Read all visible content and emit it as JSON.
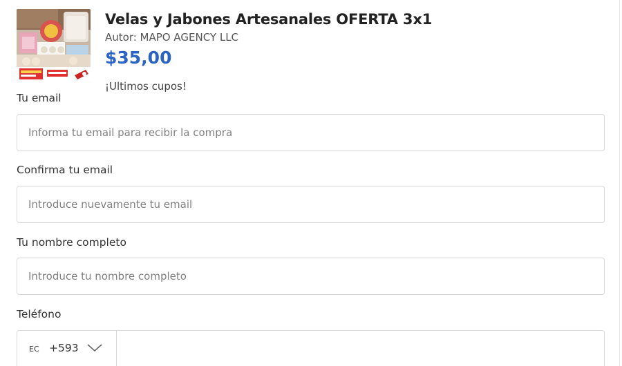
{
  "product": {
    "title": "Velas y Jabones Artesanales OFERTA 3x1",
    "author": "Autor: MAPO AGENCY LLC",
    "price": "$35,00",
    "stock_note": "¡Ultimos cupos!",
    "thumbnail_icon": "product-thumbnail-image"
  },
  "form": {
    "email": {
      "label": "Tu email",
      "placeholder": "Informa tu email para recibir la compra",
      "value": ""
    },
    "confirm_email": {
      "label": "Confirma tu email",
      "placeholder": "Introduce nuevamente tu email",
      "value": ""
    },
    "full_name": {
      "label": "Tu nombre completo",
      "placeholder": "Introduce tu nombre completo",
      "value": ""
    },
    "phone": {
      "label": "Teléfono",
      "country_code": "EC",
      "dial_code": "+593",
      "value": "",
      "dropdown_icon": "chevron-down-icon"
    }
  },
  "colors": {
    "price": "#2a63c4",
    "border": "#d7d7d7",
    "text": "#333333"
  }
}
